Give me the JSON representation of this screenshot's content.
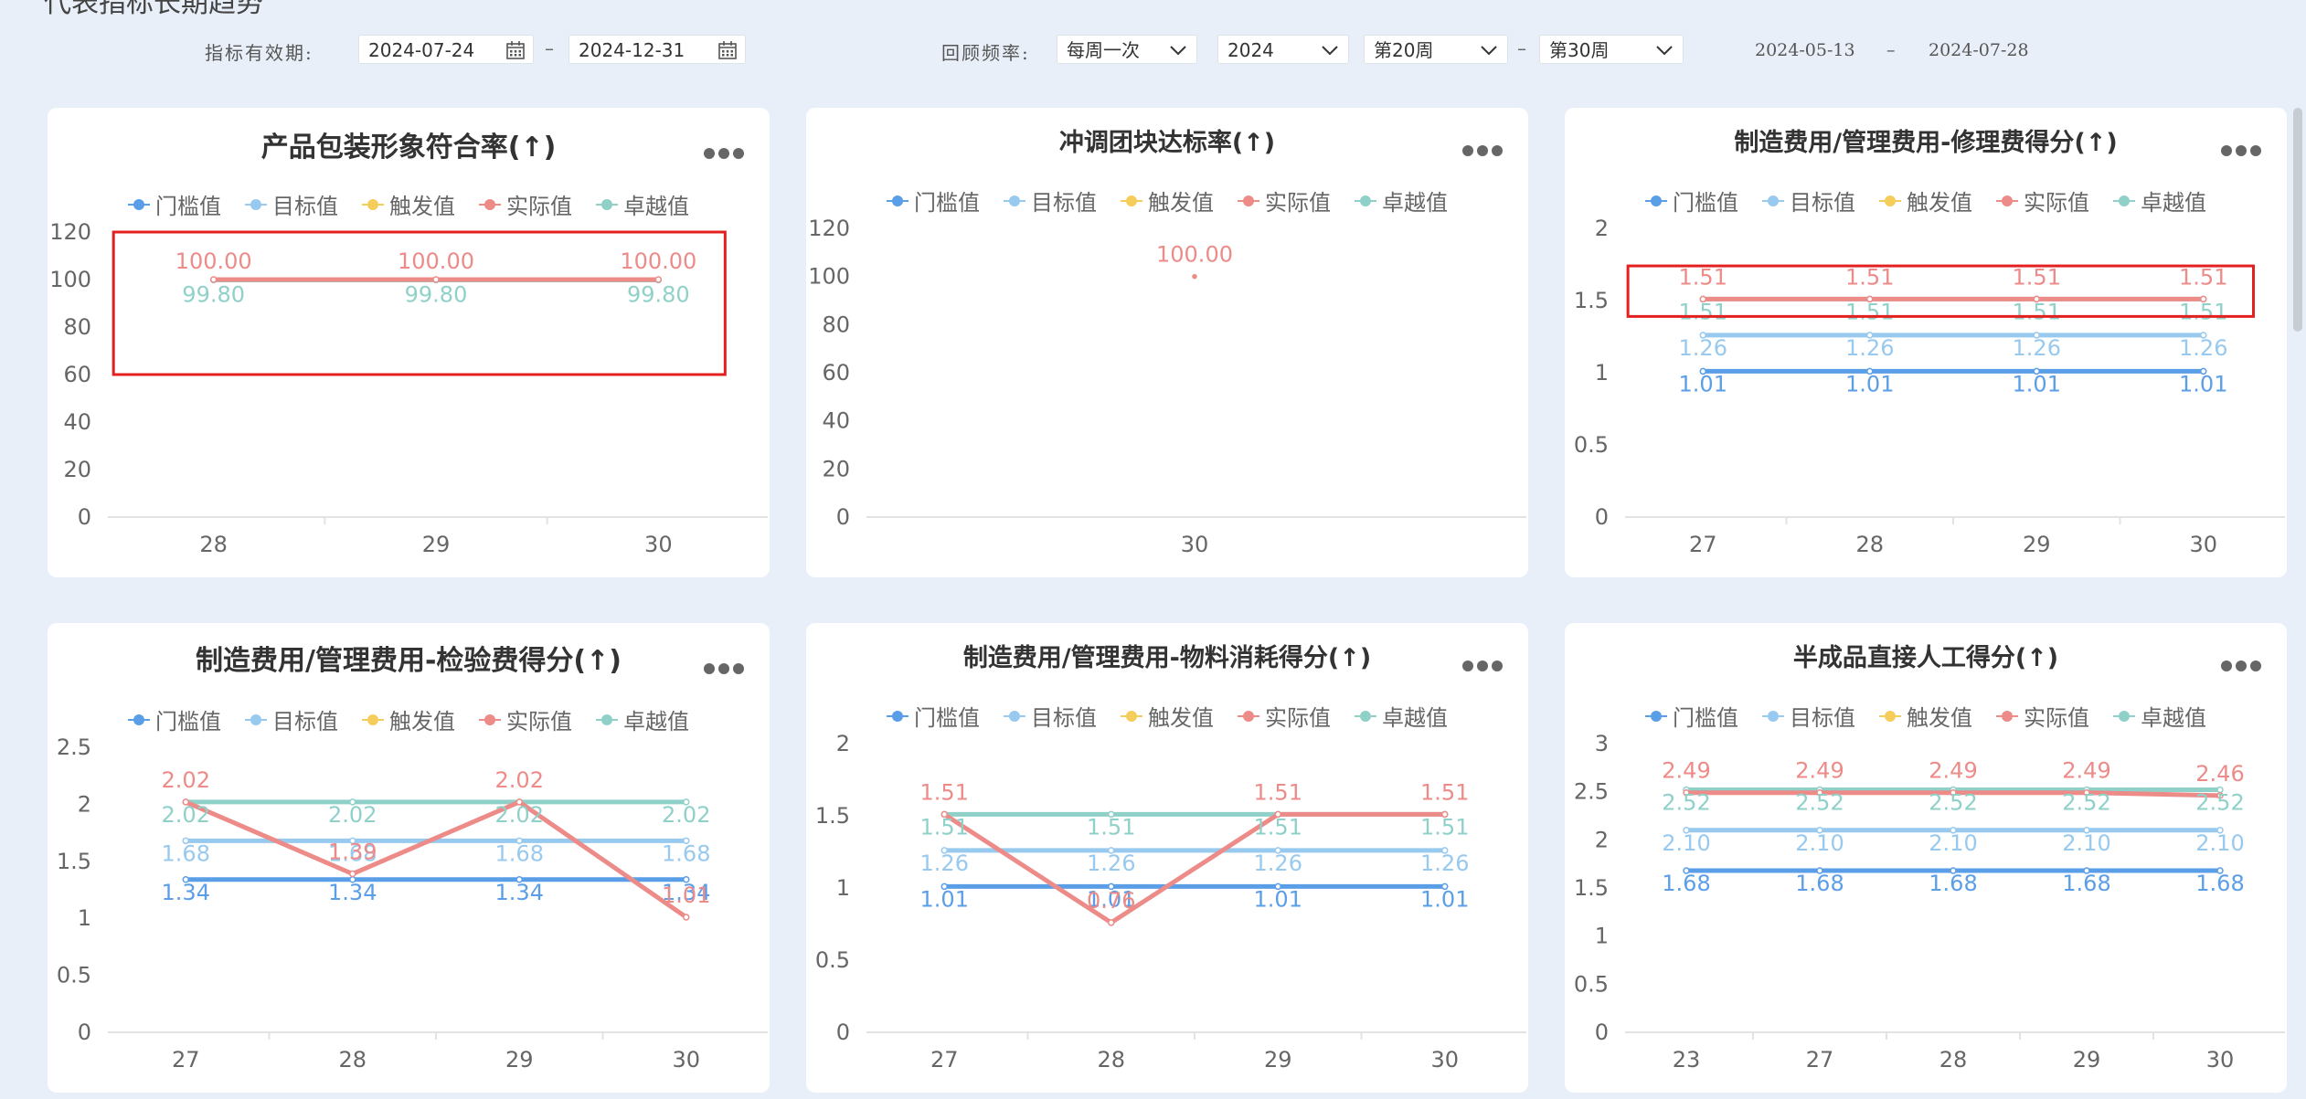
{
  "page": {
    "heading": "代表指标长期趋势"
  },
  "filters": {
    "validity_label": "指标有效期:",
    "start_date": "2024-07-24",
    "end_date": "2024-12-31",
    "date_separator": "–",
    "frequency_label": "回顾频率:",
    "frequency_value": "每周一次",
    "year_value": "2024",
    "week_from": "第20周",
    "week_separator": "–",
    "week_to": "第30周",
    "range_start": "2024-05-13",
    "range_separator": "–",
    "range_end": "2024-07-28"
  },
  "legend": [
    {
      "name": "门槛值",
      "color": "#5b9ee8"
    },
    {
      "name": "目标值",
      "color": "#98c9ee"
    },
    {
      "name": "触发值",
      "color": "#f5cd5b"
    },
    {
      "name": "实际值",
      "color": "#ec8b88"
    },
    {
      "name": "卓越值",
      "color": "#8fd1c9"
    }
  ],
  "more_icon": "more-horizontal-icon",
  "chart_data": [
    {
      "type": "line",
      "title": "产品包装形象符合率(↑)",
      "categories": [
        "28",
        "29",
        "30"
      ],
      "ylim": [
        0,
        120
      ],
      "yticks": [
        "0",
        "20",
        "40",
        "60",
        "80",
        "100",
        "120"
      ],
      "highlight": {
        "from_index": 0,
        "to_index": 2,
        "y_top": 120,
        "y_bottom": 60
      },
      "series": [
        {
          "name": "门槛值",
          "values": [
            null,
            null,
            null
          ]
        },
        {
          "name": "目标值",
          "values": [
            null,
            null,
            null
          ]
        },
        {
          "name": "触发值",
          "values": [
            null,
            null,
            null
          ]
        },
        {
          "name": "实际值",
          "values": [
            100,
            100,
            100
          ],
          "labels": [
            "100.00",
            "100.00",
            "100.00"
          ]
        },
        {
          "name": "卓越值",
          "values": [
            99.8,
            99.8,
            99.8
          ],
          "labels": [
            "99.80",
            "99.80",
            "99.80"
          ]
        }
      ]
    },
    {
      "type": "line",
      "title": "冲调团块达标率(↑)",
      "categories": [
        "30"
      ],
      "ylim": [
        0,
        120
      ],
      "yticks": [
        "0",
        "20",
        "40",
        "60",
        "80",
        "100",
        "120"
      ],
      "highlight": null,
      "series": [
        {
          "name": "门槛值",
          "values": [
            null
          ]
        },
        {
          "name": "目标值",
          "values": [
            null
          ]
        },
        {
          "name": "触发值",
          "values": [
            null
          ]
        },
        {
          "name": "实际值",
          "values": [
            100
          ],
          "labels": [
            "100.00"
          ]
        },
        {
          "name": "卓越值",
          "values": [
            null
          ]
        }
      ]
    },
    {
      "type": "line",
      "title": "制造费用/管理费用-修理费得分(↑)",
      "categories": [
        "27",
        "28",
        "29",
        "30"
      ],
      "ylim": [
        0,
        2
      ],
      "yticks": [
        "0",
        "0.5",
        "1",
        "1.5",
        "2"
      ],
      "highlight": {
        "from_index": 0,
        "to_index": 3,
        "y_top": 1.74,
        "y_bottom": 1.39
      },
      "series": [
        {
          "name": "门槛值",
          "values": [
            1.01,
            1.01,
            1.01,
            1.01
          ],
          "labels": [
            "1.01",
            "1.01",
            "1.01",
            "1.01"
          ]
        },
        {
          "name": "目标值",
          "values": [
            1.26,
            1.26,
            1.26,
            1.26
          ],
          "labels": [
            "1.26",
            "1.26",
            "1.26",
            "1.26"
          ]
        },
        {
          "name": "触发值",
          "values": [
            null,
            null,
            null,
            null
          ]
        },
        {
          "name": "实际值",
          "values": [
            1.51,
            1.51,
            1.51,
            1.51
          ],
          "labels": [
            "1.51",
            "1.51",
            "1.51",
            "1.51"
          ]
        },
        {
          "name": "卓越值",
          "values": [
            1.51,
            1.51,
            1.51,
            1.51
          ],
          "labels": [
            "1.51",
            "1.51",
            "1.51",
            "1.51"
          ]
        }
      ]
    },
    {
      "type": "line",
      "title": "制造费用/管理费用-检验费得分(↑)",
      "categories": [
        "27",
        "28",
        "29",
        "30"
      ],
      "ylim": [
        0,
        2.5
      ],
      "yticks": [
        "0",
        "0.5",
        "1",
        "1.5",
        "2",
        "2.5"
      ],
      "highlight": null,
      "series": [
        {
          "name": "门槛值",
          "values": [
            1.34,
            1.34,
            1.34,
            1.34
          ],
          "labels": [
            "1.34",
            "1.34",
            "1.34",
            "1.34"
          ]
        },
        {
          "name": "目标值",
          "values": [
            1.68,
            1.68,
            1.68,
            1.68
          ],
          "labels": [
            "1.68",
            "1.68",
            "1.68",
            "1.68"
          ]
        },
        {
          "name": "触发值",
          "values": [
            null,
            null,
            null,
            null
          ]
        },
        {
          "name": "实际值",
          "values": [
            2.02,
            1.39,
            2.02,
            1.01
          ],
          "labels": [
            "2.02",
            "1.39",
            "2.02",
            "1.01"
          ]
        },
        {
          "name": "卓越值",
          "values": [
            2.02,
            2.02,
            2.02,
            2.02
          ],
          "labels": [
            "2.02",
            "2.02",
            "2.02",
            "2.02"
          ]
        }
      ]
    },
    {
      "type": "line",
      "title": "制造费用/管理费用-物料消耗得分(↑)",
      "categories": [
        "27",
        "28",
        "29",
        "30"
      ],
      "ylim": [
        0,
        2
      ],
      "yticks": [
        "0",
        "0.5",
        "1",
        "1.5",
        "2"
      ],
      "highlight": null,
      "series": [
        {
          "name": "门槛值",
          "values": [
            1.01,
            1.01,
            1.01,
            1.01
          ],
          "labels": [
            "1.01",
            "1.01",
            "1.01",
            "1.01"
          ]
        },
        {
          "name": "目标值",
          "values": [
            1.26,
            1.26,
            1.26,
            1.26
          ],
          "labels": [
            "1.26",
            "1.26",
            "1.26",
            "1.26"
          ]
        },
        {
          "name": "触发值",
          "values": [
            null,
            null,
            null,
            null
          ]
        },
        {
          "name": "实际值",
          "values": [
            1.51,
            0.76,
            1.51,
            1.51
          ],
          "labels": [
            "1.51",
            "0.76",
            "1.51",
            "1.51"
          ]
        },
        {
          "name": "卓越值",
          "values": [
            1.51,
            1.51,
            1.51,
            1.51
          ],
          "labels": [
            "1.51",
            "1.51",
            "1.51",
            "1.51"
          ]
        }
      ]
    },
    {
      "type": "line",
      "title": "半成品直接人工得分(↑)",
      "categories": [
        "23",
        "27",
        "28",
        "29",
        "30"
      ],
      "ylim": [
        0,
        3
      ],
      "yticks": [
        "0",
        "0.5",
        "1",
        "1.5",
        "2",
        "2.5",
        "3"
      ],
      "highlight": null,
      "series": [
        {
          "name": "门槛值",
          "values": [
            1.68,
            1.68,
            1.68,
            1.68,
            1.68
          ],
          "labels": [
            "1.68",
            "1.68",
            "1.68",
            "1.68",
            "1.68"
          ]
        },
        {
          "name": "目标值",
          "values": [
            2.1,
            2.1,
            2.1,
            2.1,
            2.1
          ],
          "labels": [
            "2.10",
            "2.10",
            "2.10",
            "2.10",
            "2.10"
          ]
        },
        {
          "name": "触发值",
          "values": [
            null,
            null,
            null,
            null,
            null
          ]
        },
        {
          "name": "实际值",
          "values": [
            2.49,
            2.49,
            2.49,
            2.49,
            2.46
          ],
          "labels": [
            "2.49",
            "2.49",
            "2.49",
            "2.49",
            "2.46"
          ]
        },
        {
          "name": "卓越值",
          "values": [
            2.52,
            2.52,
            2.52,
            2.52,
            2.52
          ],
          "labels": [
            "2.52",
            "2.52",
            "2.52",
            "2.52",
            "2.52"
          ]
        }
      ]
    }
  ]
}
